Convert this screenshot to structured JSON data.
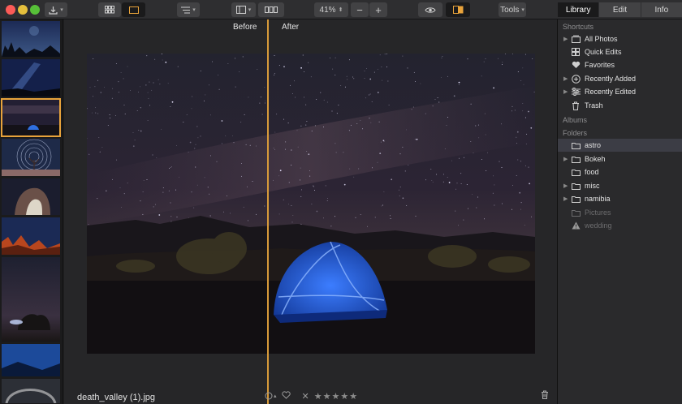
{
  "toolbar": {
    "zoom": "41%",
    "zoom_out": "−",
    "zoom_in": "+",
    "tools": "Tools",
    "accent": "#e8a33b"
  },
  "tabs": [
    {
      "label": "Library",
      "active": true
    },
    {
      "label": "Edit",
      "active": false
    },
    {
      "label": "Info",
      "active": false
    }
  ],
  "viewer": {
    "before_label": "Before",
    "after_label": "After",
    "filename": "death_valley (1).jpg",
    "rating_stars": 5,
    "star_glyph": "★",
    "reject_glyph": "✕"
  },
  "sidebar": {
    "shortcuts_title": "Shortcuts",
    "shortcuts": [
      {
        "label": "All Photos",
        "icon": "photos-stack-icon",
        "disclosure": true
      },
      {
        "label": "Quick Edits",
        "icon": "grid-icon",
        "disclosure": false
      },
      {
        "label": "Favorites",
        "icon": "heart-icon",
        "disclosure": false
      },
      {
        "label": "Recently Added",
        "icon": "plus-circle-icon",
        "disclosure": true
      },
      {
        "label": "Recently Edited",
        "icon": "sliders-icon",
        "disclosure": true
      },
      {
        "label": "Trash",
        "icon": "trash-icon",
        "disclosure": false
      }
    ],
    "albums_title": "Albums",
    "folders_title": "Folders",
    "folders": [
      {
        "label": "astro",
        "active": true,
        "disclosure": false,
        "dim": false
      },
      {
        "label": "Bokeh",
        "active": false,
        "disclosure": true,
        "dim": false
      },
      {
        "label": "food",
        "active": false,
        "disclosure": false,
        "dim": false
      },
      {
        "label": "misc",
        "active": false,
        "disclosure": true,
        "dim": false
      },
      {
        "label": "namibia",
        "active": false,
        "disclosure": true,
        "dim": false
      },
      {
        "label": "Pictures",
        "active": false,
        "disclosure": false,
        "dim": true
      },
      {
        "label": "wedding",
        "active": false,
        "disclosure": false,
        "dim": true,
        "warning": true
      }
    ]
  }
}
